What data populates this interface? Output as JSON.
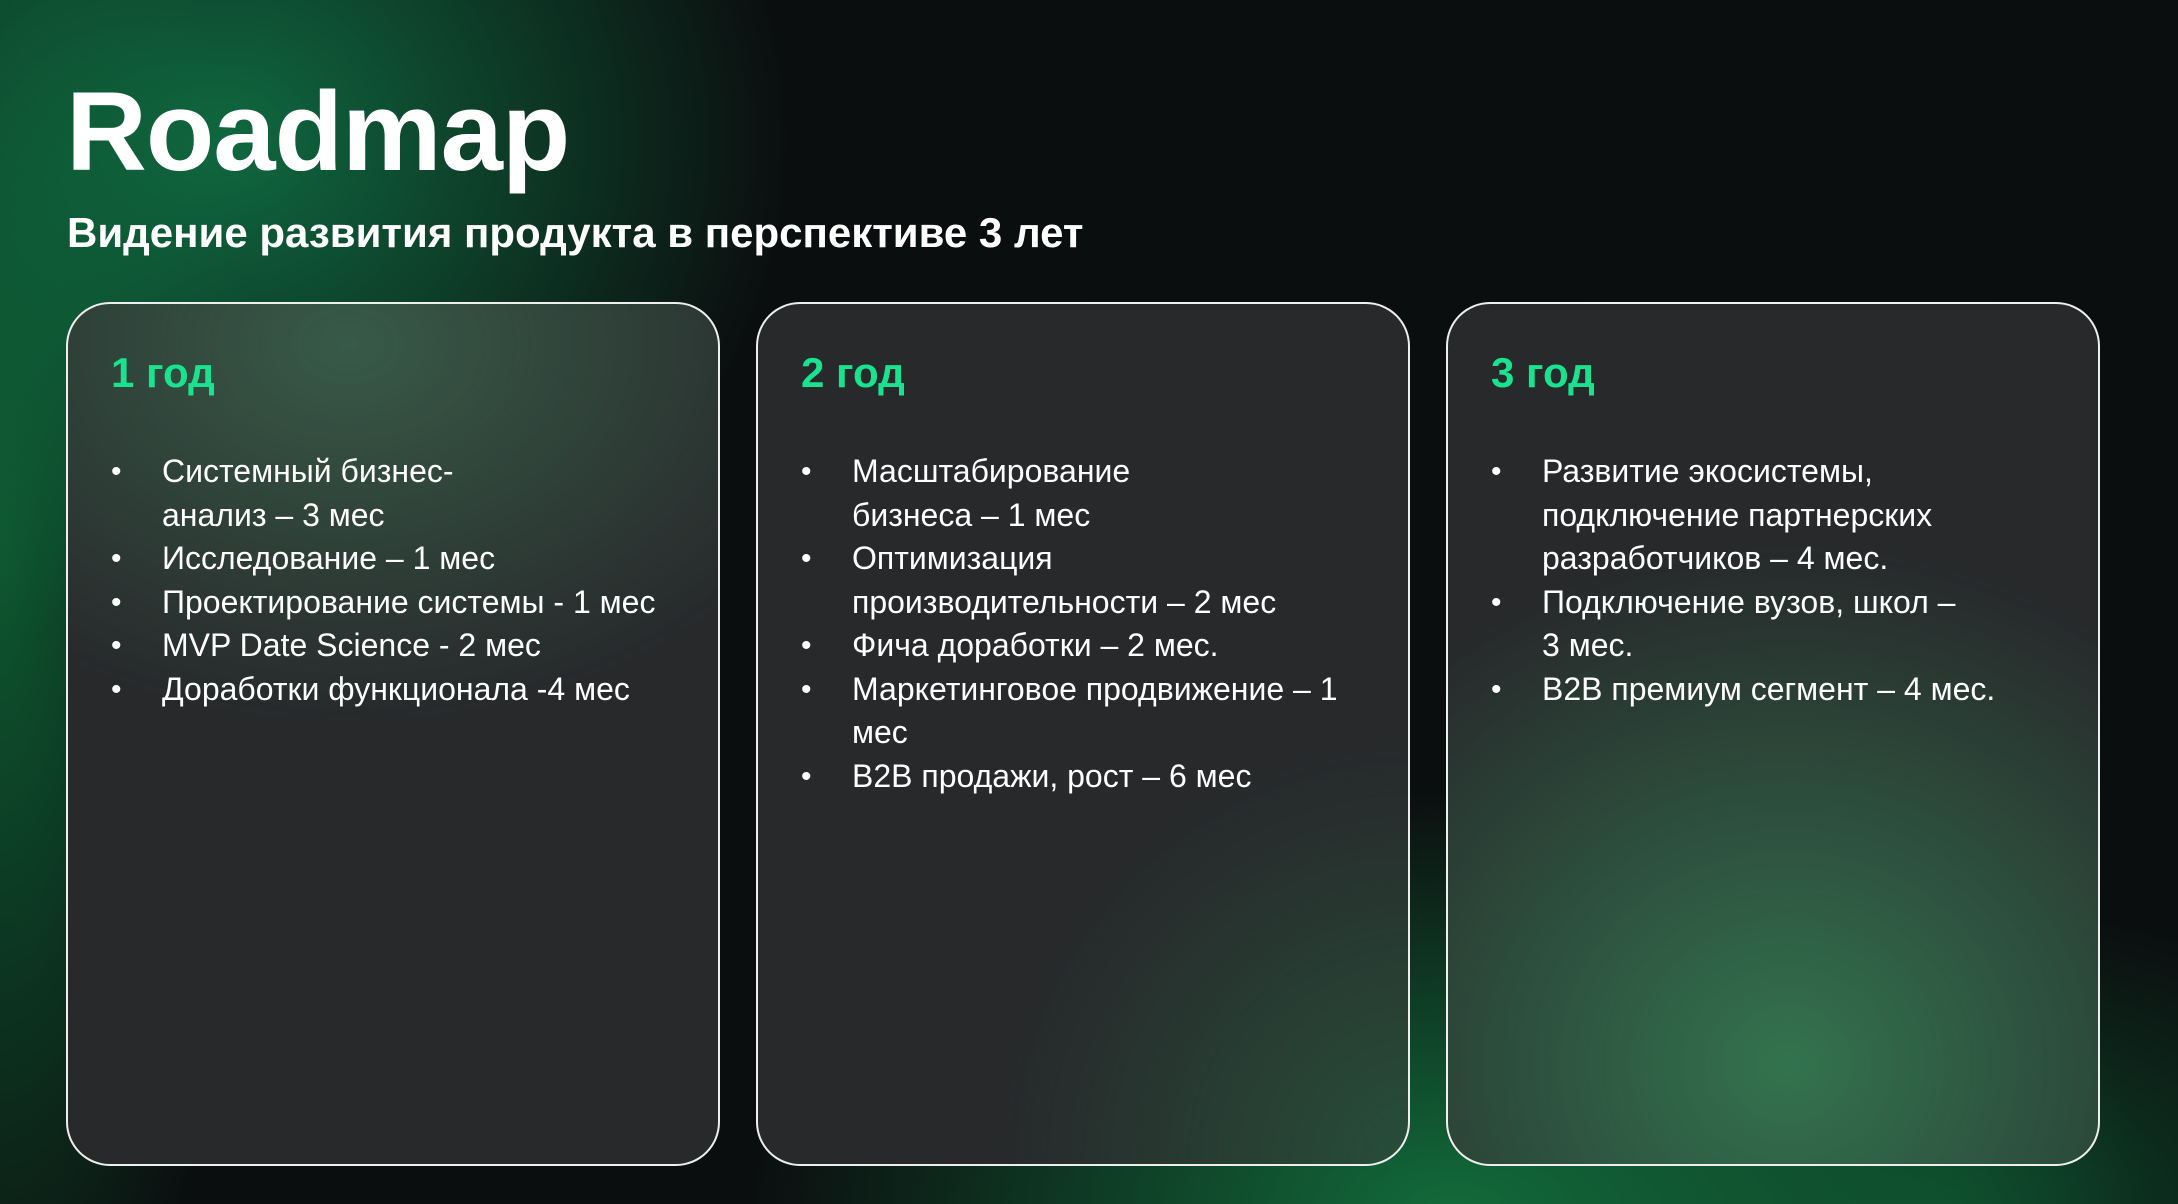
{
  "slide": {
    "title": "Roadmap",
    "subtitle": "Видение развития продукта в перспективе 3 лет"
  },
  "columns": [
    {
      "heading": "1 год",
      "items": [
        "Системный бизнес-анализ – 3 мес",
        "Исследование – 1 мес",
        "Проектирование системы - 1 мес",
        "MVP Date Science - 2 мес",
        "Доработки функционала -4 мес"
      ]
    },
    {
      "heading": "2 год",
      "items": [
        "Масштабирование бизнеса – 1 мес",
        "Оптимизация производительности – 2 мес",
        "Фича доработки – 2 мес.",
        "Маркетинговое продвижение – 1 мес",
        "B2B продажи, рост – 6 мес"
      ]
    },
    {
      "heading": "3 год",
      "items": [
        "Развитие экосистемы, подключение партнерских разработчиков – 4 мес.",
        "Подключение вузов, школ – 3 мес.",
        "B2B премиум сегмент – 4 мес."
      ]
    }
  ],
  "colors": {
    "accent": "#19e38e",
    "background": "#0b0e0f",
    "card": "#27292b",
    "text": "#ffffff"
  }
}
